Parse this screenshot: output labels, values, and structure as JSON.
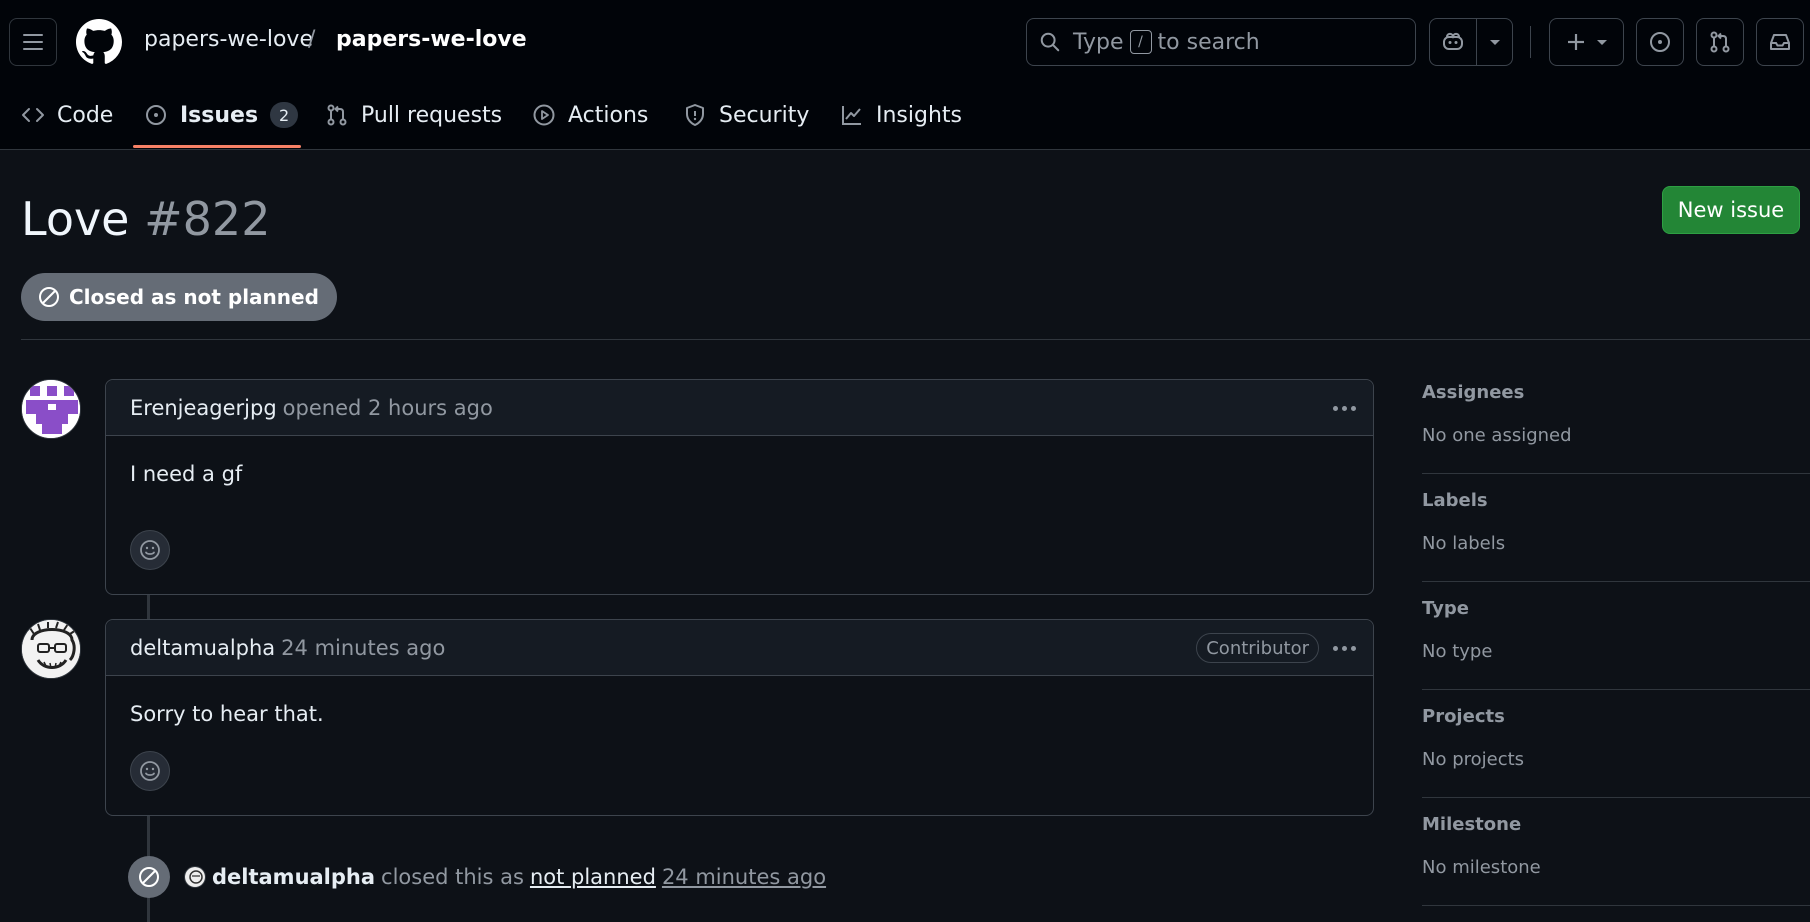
{
  "header": {
    "owner": "papers-we-love",
    "slash": "/",
    "repo": "papers-we-love",
    "search_pre": "Type",
    "search_key": "/",
    "search_post": "to search"
  },
  "tabs": [
    {
      "label": "Code",
      "icon": "code-icon"
    },
    {
      "label": "Issues",
      "count": "2",
      "icon": "issue-icon"
    },
    {
      "label": "Pull requests",
      "icon": "pull-request-icon"
    },
    {
      "label": "Actions",
      "icon": "play-icon"
    },
    {
      "label": "Security",
      "icon": "shield-icon"
    },
    {
      "label": "Insights",
      "icon": "graph-icon"
    }
  ],
  "issue": {
    "title": "Love",
    "number": "#822",
    "state": "Closed as not planned",
    "new_issue": "New issue"
  },
  "comments": [
    {
      "author": "Erenjeagerjpg",
      "meta": "opened 2 hours ago",
      "body": "I need a gf"
    },
    {
      "author": "deltamualpha",
      "meta": "24 minutes ago",
      "badge": "Contributor",
      "body": "Sorry to hear that."
    }
  ],
  "event": {
    "actor": "deltamualpha",
    "action": "closed this as",
    "reason": "not planned",
    "time": "24 minutes ago"
  },
  "sidebar": [
    {
      "heading": "Assignees",
      "value": "No one assigned"
    },
    {
      "heading": "Labels",
      "value": "No labels"
    },
    {
      "heading": "Type",
      "value": "No type"
    },
    {
      "heading": "Projects",
      "value": "No projects"
    },
    {
      "heading": "Milestone",
      "value": "No milestone"
    }
  ],
  "colors": {
    "background": "#0d1117",
    "header": "#010409",
    "accent_underline": "#f78166",
    "new_issue_green": "#238636",
    "closed_badge": "#656c76"
  }
}
